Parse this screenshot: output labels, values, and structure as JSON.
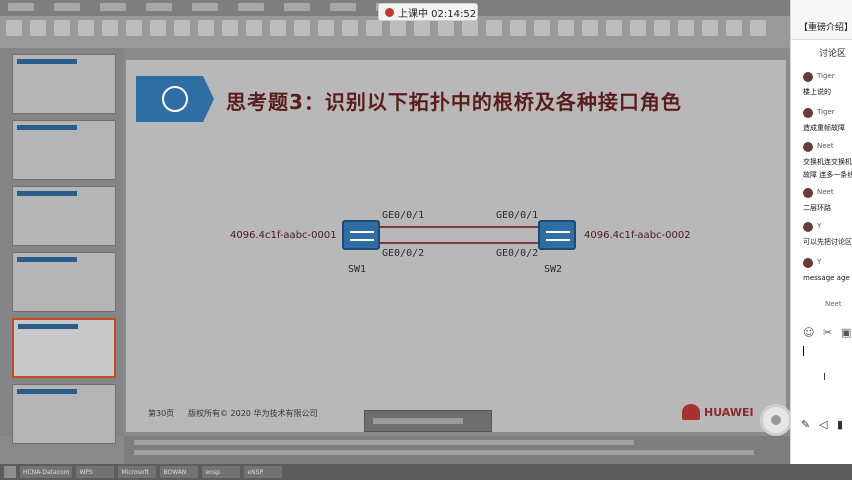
{
  "recording": {
    "label": "上课中 02:14:52"
  },
  "slide": {
    "title": "思考题3：识别以下拓扑中的根桥及各种接口角色",
    "sw1": {
      "name": "SW1",
      "mac": "4096.4c1f-aabc-0001",
      "port_top": "GE0/0/1",
      "port_bottom": "GE0/0/2"
    },
    "sw2": {
      "name": "SW2",
      "mac": "4096.4c1f-aabc-0002",
      "port_top": "GE0/0/1",
      "port_bottom": "GE0/0/2"
    },
    "footer_page": "第30页",
    "footer_copy": "版权所有© 2020 华为技术有限公司",
    "brand": "HUAWEI"
  },
  "panel": {
    "tab_label": "【重磅介绍】",
    "title": "讨论区",
    "messages": [
      {
        "name": "Tiger",
        "text": "楼上说的"
      },
      {
        "name": "Tiger",
        "text": "造成重帧故障"
      },
      {
        "name": "Neet",
        "text": "交换机连交换机\n故障 连多一条线"
      },
      {
        "name": "Neet",
        "text": "二层环路"
      },
      {
        "name": "Y",
        "text": "可以先把讨论区"
      },
      {
        "name": "Y",
        "text": "message age"
      }
    ],
    "typing": "Neet"
  },
  "taskbar": {
    "items": [
      "HCNA-Datacom",
      "WPS",
      "Microsoft",
      "BOWAN",
      "ensp",
      "eNSP"
    ]
  },
  "colors": {
    "accent": "#2f6da5",
    "title": "#5a1d1d",
    "live_dot": "#c0392b"
  }
}
